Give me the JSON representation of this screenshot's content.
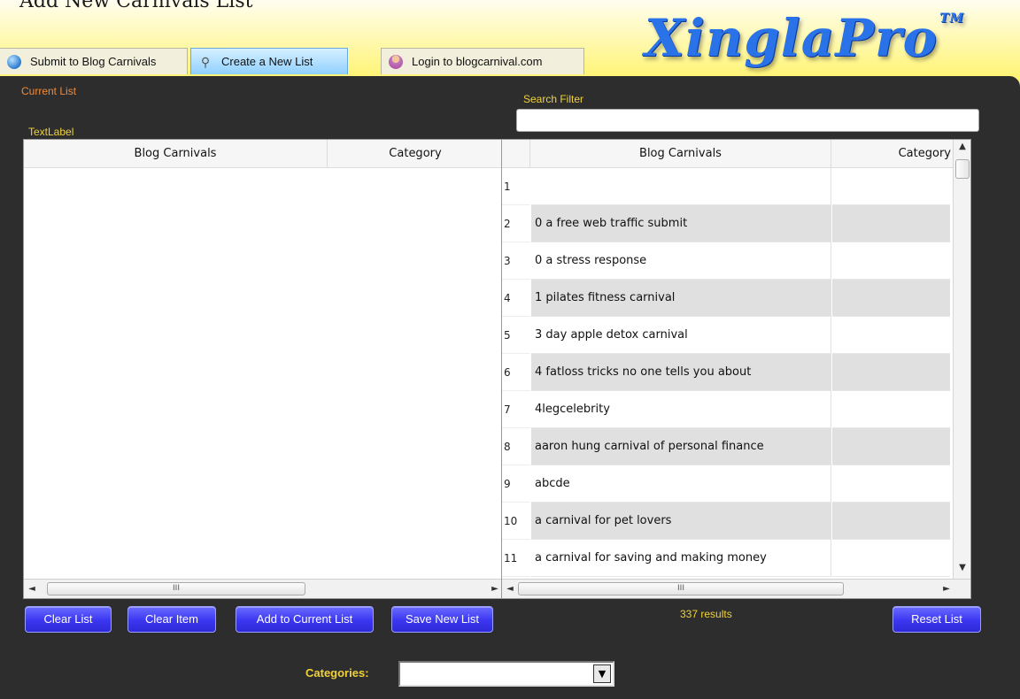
{
  "window": {
    "title": "Add New Carnivals List"
  },
  "logo": {
    "text": "XinglaPro",
    "tm": "TM"
  },
  "tabs": [
    {
      "label": "Submit to Blog Carnivals",
      "icon": "globe-icon"
    },
    {
      "label": "Create a New List",
      "icon": "magnifier-icon",
      "active": true
    },
    {
      "label": "Login to blogcarnival.com",
      "icon": "user-icon"
    }
  ],
  "left": {
    "current_list_label": "Current List",
    "textlabel": "TextLabel",
    "columns": [
      "Blog Carnivals",
      "Category"
    ]
  },
  "right": {
    "search_label": "Search Filter",
    "search_value": "",
    "columns": [
      "Blog Carnivals",
      "Category"
    ],
    "rows": [
      {
        "num": "1",
        "name": "",
        "category": ""
      },
      {
        "num": "2",
        "name": "0 a free web traffic submit",
        "category": ""
      },
      {
        "num": "3",
        "name": "0 a stress response",
        "category": ""
      },
      {
        "num": "4",
        "name": "1 pilates fitness carnival",
        "category": ""
      },
      {
        "num": "5",
        "name": "3 day  apple detox carnival",
        "category": ""
      },
      {
        "num": "6",
        "name": "4 fatloss tricks no one tells you about",
        "category": ""
      },
      {
        "num": "7",
        "name": "4legcelebrity",
        "category": ""
      },
      {
        "num": "8",
        "name": "aaron hung carnival of personal finance",
        "category": ""
      },
      {
        "num": "9",
        "name": "abcde",
        "category": ""
      },
      {
        "num": "10",
        "name": "a carnival for pet lovers",
        "category": ""
      },
      {
        "num": "11",
        "name": "a carnival for saving and making money",
        "category": ""
      }
    ],
    "results_text": "337 results"
  },
  "scrollbar": {
    "thumb_glyph": "III",
    "left_arrow": "◄",
    "right_arrow": "►",
    "up_arrow": "▲",
    "down_arrow": "▼"
  },
  "buttons": {
    "clear_list": "Clear List",
    "clear_item": "Clear Item",
    "add_to_current": "Add to Current List",
    "save_new_list": "Save New List",
    "reset_list": "Reset List"
  },
  "categories": {
    "label": "Categories:",
    "selected": ""
  },
  "colors": {
    "accent_blue": "#3b36f0",
    "panel_bg": "#2d2d2d",
    "label_orange": "#f08a3a",
    "label_yellow": "#f0d23a"
  }
}
